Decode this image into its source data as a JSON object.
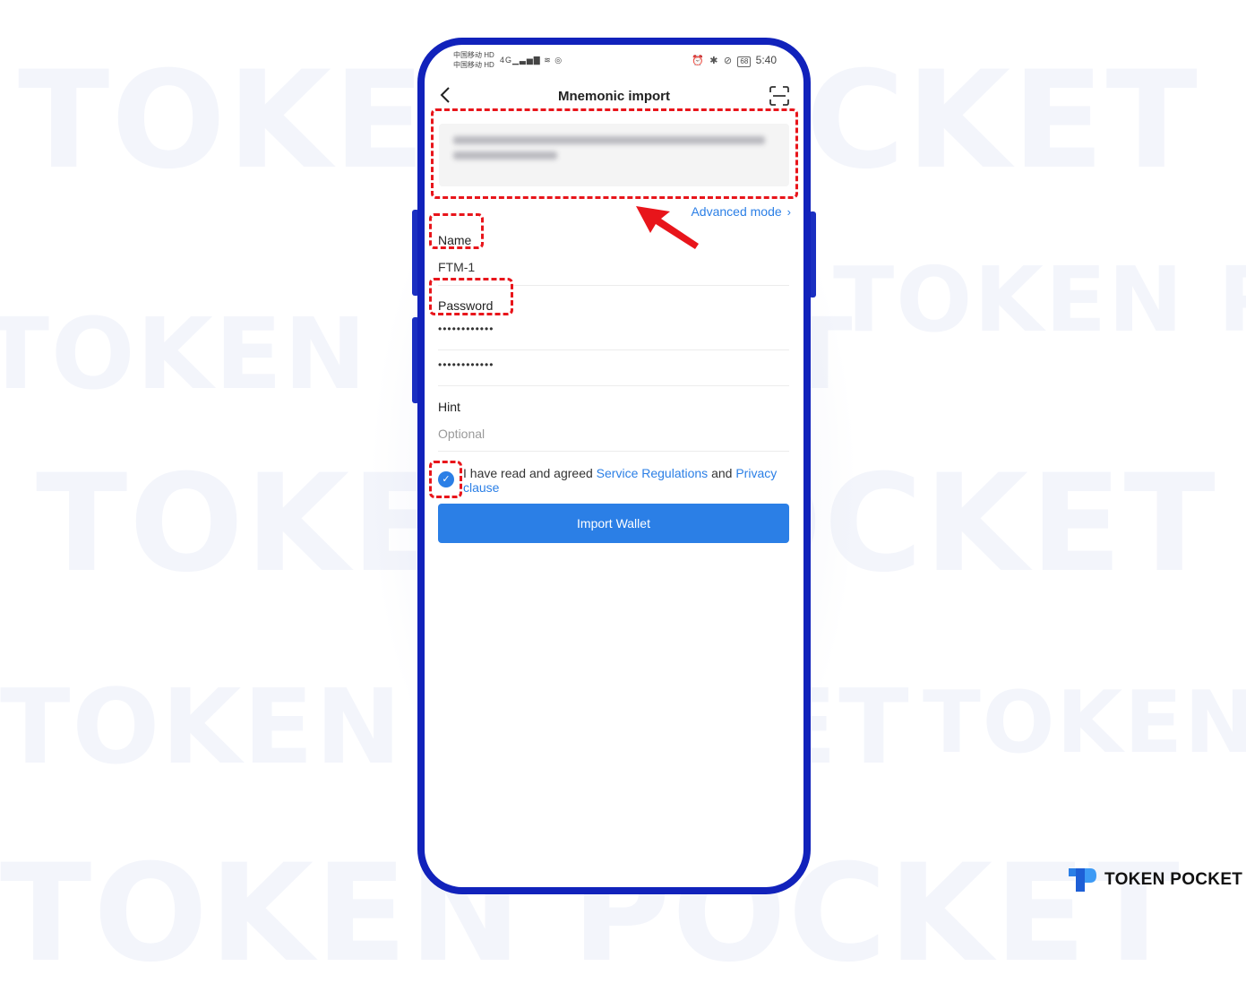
{
  "watermark": {
    "text": "TOKEN POCKET"
  },
  "status_bar": {
    "carrier_1": "中国移动 HD",
    "carrier_2": "中国移动 HD",
    "network": "4G",
    "battery": "68",
    "time": "5:40"
  },
  "nav": {
    "title": "Mnemonic import"
  },
  "mnemonic": {
    "value": "•••••••• •••••••••• ••••• ••••••••••••••••••• •••••••• ••••• •••••••••••••"
  },
  "advanced_mode": {
    "label": "Advanced mode"
  },
  "form": {
    "name_label": "Name",
    "name_value": "FTM-1",
    "password_label": "Password",
    "password_value": "••••••••••••",
    "password_confirm_value": "••••••••••••",
    "hint_label": "Hint",
    "hint_placeholder": "Optional"
  },
  "agreement": {
    "checked": true,
    "prefix": "I have read and agreed ",
    "service_link": "Service Regulations",
    "middle": " and ",
    "privacy_link": "Privacy clause"
  },
  "import_button": {
    "label": "Import Wallet"
  },
  "brand": {
    "name": "TOKEN POCKET"
  },
  "colors": {
    "accent": "#2b7fe6",
    "phone_frame": "#1122bb",
    "highlight": "#e8151b"
  }
}
